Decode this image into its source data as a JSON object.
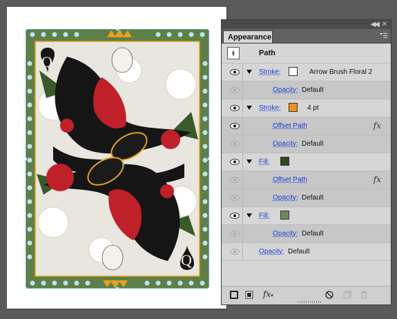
{
  "panel": {
    "tab_label": "Appearance",
    "collapse_glyph": "◀◀",
    "close_glyph": "✕",
    "tab_close_glyph": "▾",
    "menu_icon": "panel-menu-icon"
  },
  "header": {
    "title": "Path"
  },
  "rows": [
    {
      "kind": "stroke",
      "label": "Stroke:",
      "swatch": "#ffffff",
      "value": "Arrow Brush Floral 2",
      "visible": true
    },
    {
      "kind": "opacity",
      "label": "Opacity:",
      "value": "Default",
      "visible": false
    },
    {
      "kind": "stroke",
      "label": "Stroke:",
      "swatch": "#f0901e",
      "value": "4 pt",
      "visible": true
    },
    {
      "kind": "effect",
      "label": "Offset Path",
      "visible": true
    },
    {
      "kind": "opacity",
      "label": "Opacity:",
      "value": "Default",
      "visible": false
    },
    {
      "kind": "fill",
      "label": "Fill:",
      "swatch": "#2f4a1a",
      "visible": true
    },
    {
      "kind": "effect",
      "label": "Offset Path",
      "visible": false
    },
    {
      "kind": "opacity",
      "label": "Opacity:",
      "value": "Default",
      "visible": false
    },
    {
      "kind": "fill",
      "label": "Fill:",
      "swatch": "#6b8a55",
      "visible": true
    },
    {
      "kind": "opacity",
      "label": "Opacity:",
      "value": "Default",
      "visible": false
    },
    {
      "kind": "object-opacity",
      "label": "Opacity:",
      "value": "Default",
      "visible": false
    }
  ],
  "fx_label": "fx",
  "bottom_bar": {
    "fx_label": "fx"
  },
  "card": {
    "rank_top": "Q",
    "rank_bottom": "Q",
    "colors": {
      "border": "#5e7f48",
      "dots": "#bfe4ec",
      "red": "#c0202a",
      "hair": "#151515",
      "gold": "#e8a21a"
    }
  }
}
